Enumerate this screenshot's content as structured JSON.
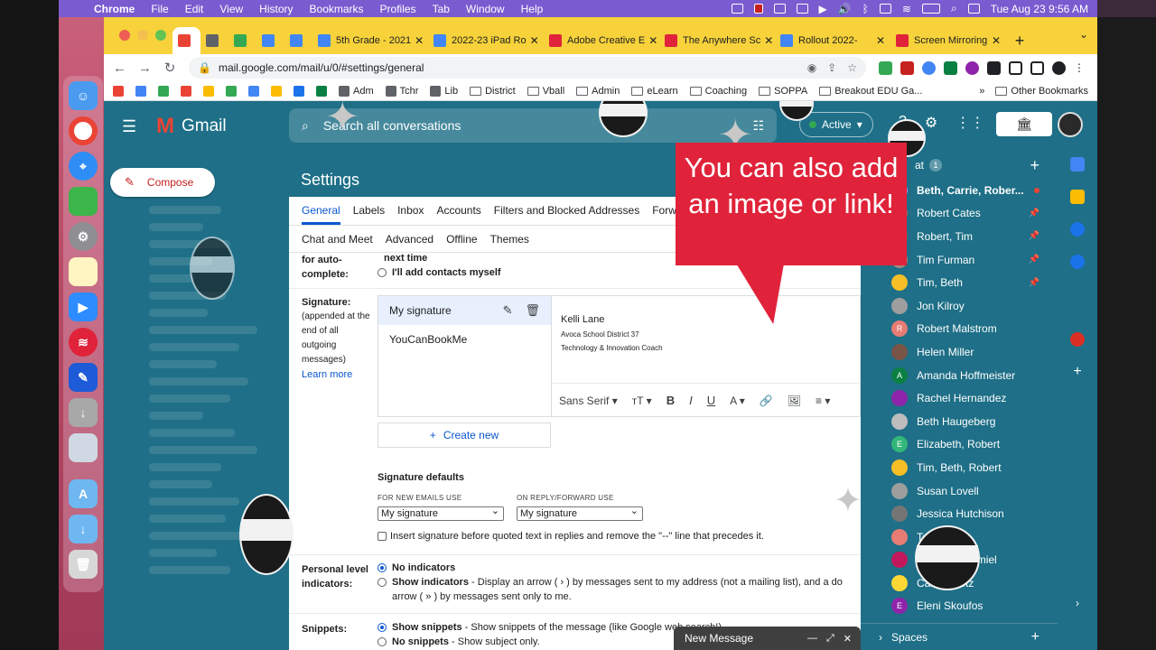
{
  "mac_menu": {
    "app": "Chrome",
    "items": [
      "File",
      "Edit",
      "View",
      "History",
      "Bookmarks",
      "Profiles",
      "Tab",
      "Window",
      "Help"
    ],
    "datetime": "Tue Aug 23  9:56 AM"
  },
  "browser": {
    "tabs": [
      {
        "label": "",
        "favicon_color": "#ea4335",
        "active": true,
        "size": "small"
      },
      {
        "label": "",
        "favicon_color": "#5f6368",
        "size": "small"
      },
      {
        "label": "",
        "favicon_color": "#34a853",
        "size": "small"
      },
      {
        "label": "",
        "favicon_color": "#4285f4",
        "size": "small"
      },
      {
        "label": "",
        "favicon_color": "#4285f4",
        "size": "small"
      },
      {
        "label": "5th Grade - 2021",
        "favicon_color": "#4285f4"
      },
      {
        "label": "2022-23 iPad Ro",
        "favicon_color": "#4285f4"
      },
      {
        "label": "Adobe Creative E",
        "favicon_color": "#e0233a"
      },
      {
        "label": "The Anywhere Sc",
        "favicon_color": "#e0233a"
      },
      {
        "label": "Rollout 2022-",
        "favicon_color": "#4285f4"
      },
      {
        "label": "Screen Mirroring",
        "favicon_color": "#e0233a"
      }
    ],
    "url": "mail.google.com/mail/u/0/#settings/general",
    "bookmarks": [
      "Adm",
      "Tchr",
      "Lib",
      "District",
      "Vball",
      "Admin",
      "eLearn",
      "Coaching",
      "SOPPA",
      "Breakout EDU Ga..."
    ],
    "bookmarks_overflow": "»",
    "other_bookmarks": "Other Bookmarks"
  },
  "gmail": {
    "brand": "Gmail",
    "search_placeholder": "Search all conversations",
    "status": "Active",
    "compose": "Compose",
    "settings_title": "Settings",
    "tabs_row1": [
      "General",
      "Labels",
      "Inbox",
      "Accounts",
      "Filters and Blocked Addresses",
      "Forw"
    ],
    "tabs_row2": [
      "Chat and Meet",
      "Advanced",
      "Offline",
      "Themes"
    ],
    "autocomplete": {
      "label": "for auto-complete:",
      "next_time": "next time",
      "option": "I'll add contacts myself"
    },
    "signature": {
      "label": "Signature:",
      "desc": "(appended at the end of all outgoing messages)",
      "learn_more": "Learn more",
      "items": [
        "My signature",
        "YouCanBookMe"
      ],
      "text_name": "Kelli Lane",
      "text_line2": "Avoca School District 37",
      "text_line3": "Technology & Innovation Coach",
      "font": "Sans Serif",
      "create_new": "Create new"
    },
    "signature_defaults": {
      "title": "Signature defaults",
      "new_label": "FOR NEW EMAILS USE",
      "new_value": "My signature",
      "reply_label": "ON REPLY/FORWARD USE",
      "reply_value": "My signature",
      "insert_text": "Insert signature before quoted text in replies and remove the \"--\" line that precedes it."
    },
    "personal_indicators": {
      "label": "Personal level indicators:",
      "opt1": "No indicators",
      "opt2_bold": "Show indicators",
      "opt2_rest": " - Display an arrow ( › ) by messages sent to my address (not a mailing list), and a do",
      "opt2_line2": "arrow ( » ) by messages sent only to me."
    },
    "snippets": {
      "label": "Snippets:",
      "opt1_bold": "Show snippets",
      "opt1_rest": " - Show snippets of the message (like Google web search!).",
      "opt2_bold": "No snippets",
      "opt2_rest": " - Show subject only."
    },
    "callout": "You can also add an image or link!",
    "chat": {
      "header": "at",
      "count": "1",
      "contacts": [
        {
          "name": "Beth, Carrie, Rober...",
          "bold": true,
          "unread": true,
          "color": "#c58af9",
          "initial": ""
        },
        {
          "name": "Robert Cates",
          "pinned": true,
          "color": "#8d6e63",
          "initial": ""
        },
        {
          "name": "Robert, Tim",
          "pinned": true,
          "color": "#5f6368",
          "initial": ""
        },
        {
          "name": "Tim Furman",
          "pinned": true,
          "color": "#a1887f",
          "initial": ""
        },
        {
          "name": "Tim, Beth",
          "pinned": true,
          "color": "#f6bf26",
          "initial": ""
        },
        {
          "name": "Jon Kilroy",
          "color": "#9e9e9e",
          "initial": ""
        },
        {
          "name": "Robert Malstrom",
          "color": "#e67c73",
          "initial": "R"
        },
        {
          "name": "Helen Miller",
          "color": "#795548",
          "initial": ""
        },
        {
          "name": "Amanda Hoffmeister",
          "color": "#0b8043",
          "initial": "A"
        },
        {
          "name": "Rachel Hernandez",
          "color": "#8e24aa",
          "initial": ""
        },
        {
          "name": "Beth Haugeberg",
          "color": "#bdbdbd",
          "initial": ""
        },
        {
          "name": "Elizabeth, Robert",
          "color": "#33b679",
          "initial": "E"
        },
        {
          "name": "Tim, Beth, Robert",
          "color": "#f6bf26",
          "initial": ""
        },
        {
          "name": "Susan Lovell",
          "color": "#9e9e9e",
          "initial": ""
        },
        {
          "name": "Jessica Hutchison",
          "color": "#757575",
          "initial": ""
        },
        {
          "name": "Tom Erf",
          "color": "#e67c73",
          "initial": ""
        },
        {
          "name": "Jennifer Schmiel",
          "color": "#c2185b",
          "initial": ""
        },
        {
          "name": "Carrie Stotz",
          "color": "#fdd835",
          "initial": ""
        },
        {
          "name": "Eleni Skoufos",
          "color": "#8e24aa",
          "initial": "E"
        }
      ],
      "spaces": "Spaces"
    },
    "new_message": "New Message"
  }
}
